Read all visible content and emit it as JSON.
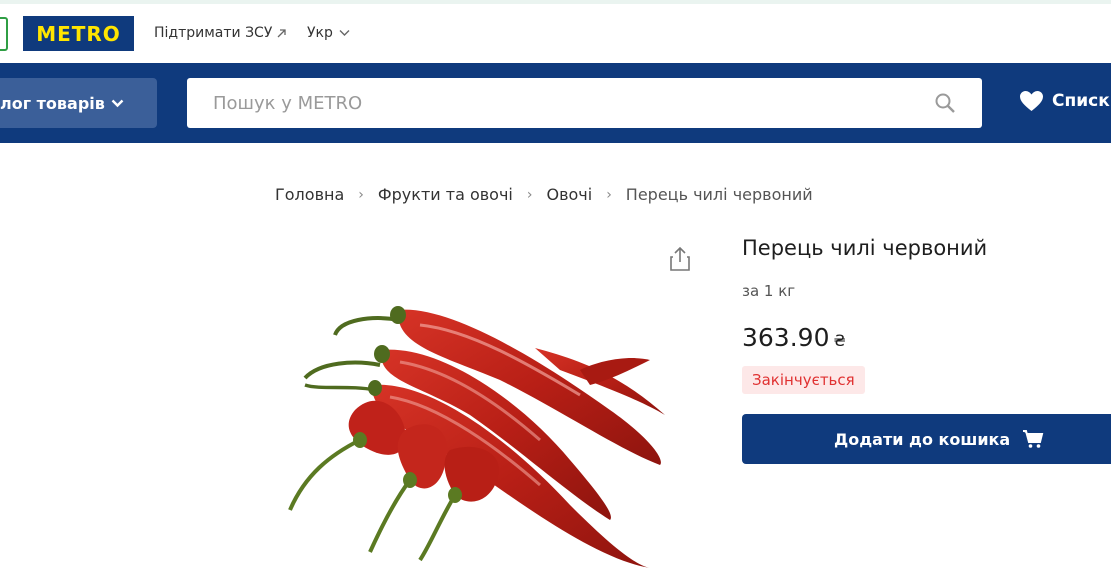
{
  "header": {
    "logo": "METRO",
    "support_link": "Підтримати ЗСУ",
    "language": "Укр"
  },
  "nav": {
    "catalog_label": "лог товарів",
    "search_placeholder": "Пошук у METRO",
    "lists_label": "Списки"
  },
  "breadcrumb": [
    "Головна",
    "Фрукти та овочі",
    "Овочі",
    "Перець чилі червоний"
  ],
  "product": {
    "title": "Перець чилі червоний",
    "unit": "за 1 кг",
    "price": "363.90",
    "currency": "₴",
    "stock_status": "Закінчується",
    "add_to_cart_label": "Додати до кошика"
  },
  "colors": {
    "brand_blue": "#0f3a7d",
    "brand_yellow": "#ffe500",
    "alert_red": "#e03131"
  }
}
